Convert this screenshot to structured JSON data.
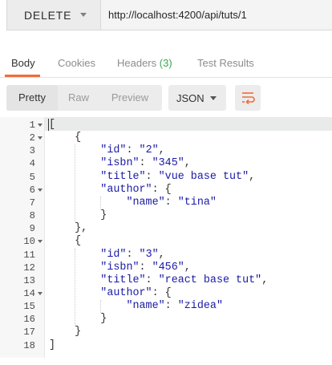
{
  "request": {
    "method": "DELETE",
    "url": "http://localhost:4200/api/tuts/1"
  },
  "tabs": [
    {
      "label": "Body"
    },
    {
      "label": "Cookies"
    },
    {
      "label": "Headers",
      "count": "(3)"
    },
    {
      "label": "Test Results"
    }
  ],
  "toolbar": {
    "pretty": "Pretty",
    "raw": "Raw",
    "preview": "Preview",
    "format": "JSON",
    "wrap_icon": "wrap-lines-icon"
  },
  "colors": {
    "accent": "#f26b3a",
    "count_green": "#37a852",
    "code_string": "#1a1aa6"
  },
  "code": {
    "lines": [
      "[",
      "    {",
      "        \"id\": \"2\",",
      "        \"isbn\": \"345\",",
      "        \"title\": \"vue base tut\",",
      "        \"author\": {",
      "            \"name\": \"tina\"",
      "        }",
      "    },",
      "    {",
      "        \"id\": \"3\",",
      "        \"isbn\": \"456\",",
      "        \"title\": \"react base tut\",",
      "        \"author\": {",
      "            \"name\": \"zidea\"",
      "        }",
      "    }",
      "]"
    ],
    "line_numbers": [
      "1",
      "2",
      "3",
      "4",
      "5",
      "6",
      "7",
      "8",
      "9",
      "10",
      "11",
      "12",
      "13",
      "14",
      "15",
      "16",
      "17",
      "18"
    ],
    "fold_lines": [
      "1",
      "2",
      "6",
      "10",
      "14"
    ]
  }
}
